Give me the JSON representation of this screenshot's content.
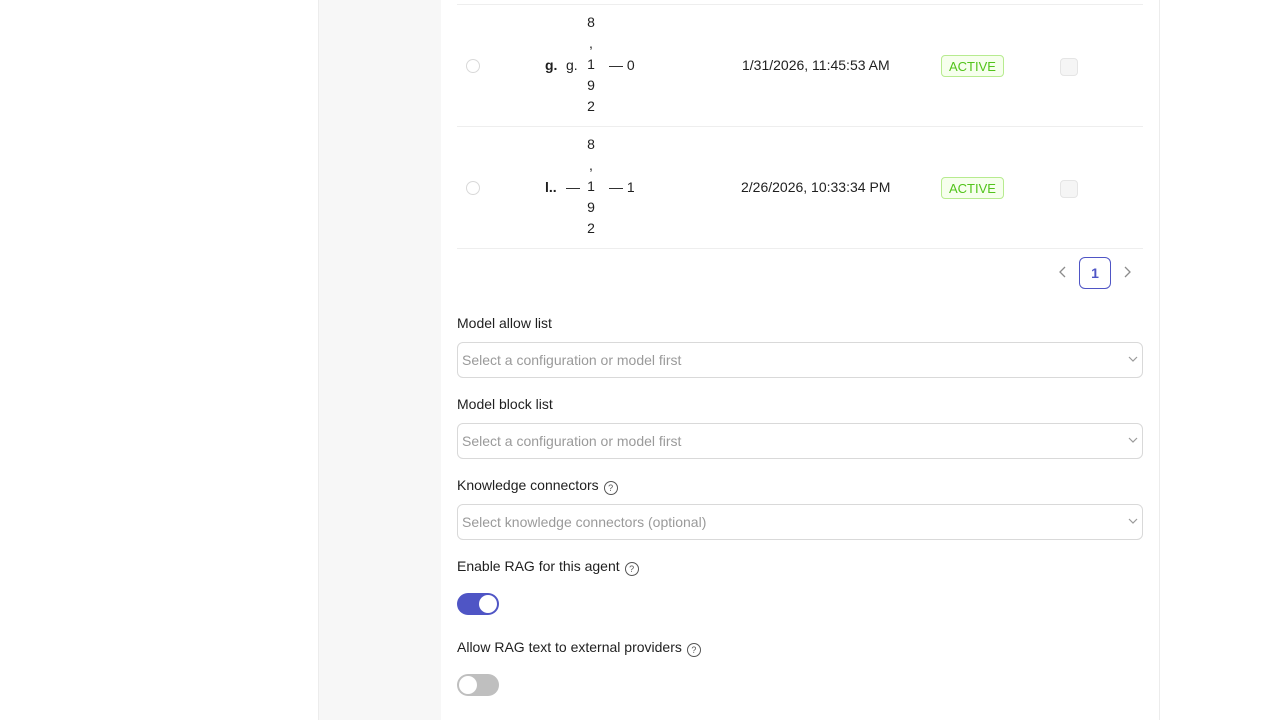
{
  "table": {
    "rows": [
      {
        "name": "g.",
        "col2": "g.",
        "limit_chars": [
          "8",
          ",",
          "1",
          "9",
          "2"
        ],
        "col4": "— 0",
        "created": "1/31/2026, 11:45:53 AM",
        "status": "ACTIVE"
      },
      {
        "name": "l..",
        "col2": "—",
        "limit_chars": [
          "8",
          ",",
          "1",
          "9",
          "2"
        ],
        "col4": "— 1",
        "created": "2/26/2026, 10:33:34 PM",
        "status": "ACTIVE"
      }
    ]
  },
  "pagination": {
    "current_page": "1",
    "prev_icon": "chevron-left-icon",
    "next_icon": "chevron-right-icon"
  },
  "fields": {
    "allow_list": {
      "label": "Model allow list",
      "placeholder": "Select a configuration or model first"
    },
    "block_list": {
      "label": "Model block list",
      "placeholder": "Select a configuration or model first"
    },
    "knowledge_connectors": {
      "label": "Knowledge connectors",
      "placeholder": "Select knowledge connectors (optional)"
    },
    "enable_rag": {
      "label": "Enable RAG for this agent",
      "enabled": true
    },
    "allow_rag_external": {
      "label": "Allow RAG text to external providers",
      "enabled": false
    }
  },
  "colors": {
    "accent": "#4f55c5",
    "status_active": "#52c41a"
  }
}
